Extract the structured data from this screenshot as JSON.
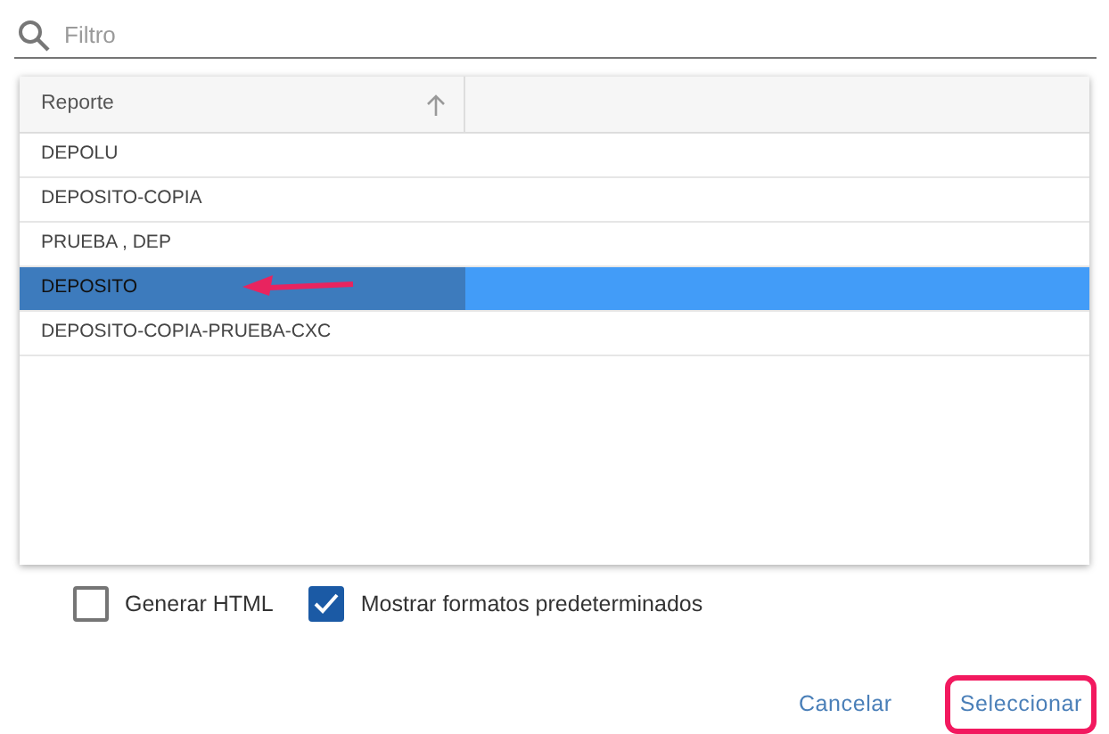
{
  "search": {
    "placeholder": "Filtro"
  },
  "table": {
    "columns": [
      {
        "label": "Reporte",
        "sorted_ascending": true
      }
    ],
    "rows": [
      {
        "cells": [
          "DEPOLU"
        ],
        "selected": false,
        "pointer_arrow": false
      },
      {
        "cells": [
          "DEPOSITO-COPIA"
        ],
        "selected": false,
        "pointer_arrow": false
      },
      {
        "cells": [
          "PRUEBA , DEP"
        ],
        "selected": false,
        "pointer_arrow": false
      },
      {
        "cells": [
          "DEPOSITO"
        ],
        "selected": true,
        "pointer_arrow": true
      },
      {
        "cells": [
          "DEPOSITO-COPIA-PRUEBA-CXC"
        ],
        "selected": false,
        "pointer_arrow": false
      }
    ]
  },
  "options": [
    {
      "label": "Generar HTML",
      "checked": false
    },
    {
      "label": "Mostrar formatos predeterminados",
      "checked": true
    }
  ],
  "buttons": [
    {
      "label": "Cancelar",
      "highlighted": false
    },
    {
      "label": "Seleccionar",
      "highlighted": true
    }
  ]
}
